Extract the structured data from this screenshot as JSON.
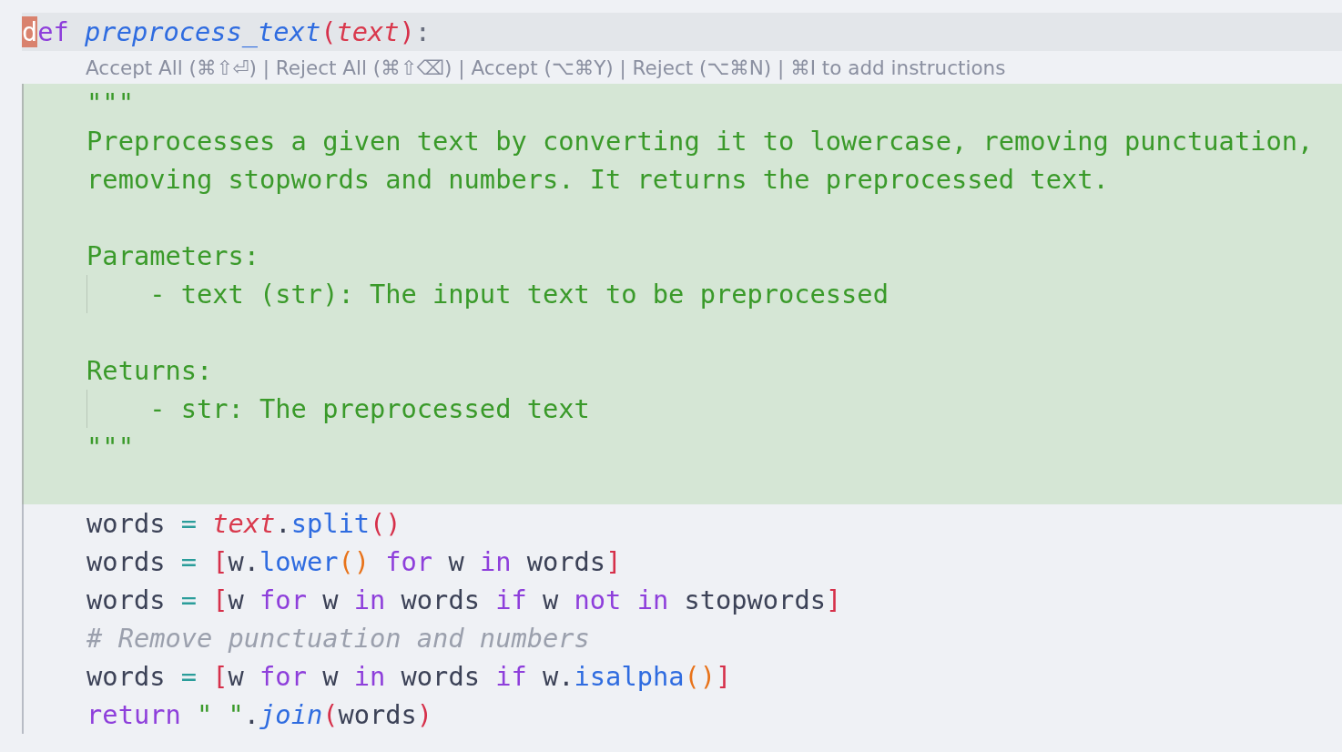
{
  "editor": {
    "header_line": {
      "tokens": [
        {
          "t": "d",
          "kind": "cursor"
        },
        {
          "t": "ef",
          "kind": "keyword"
        },
        {
          "t": " preprocess_text",
          "kind": "defname"
        },
        {
          "t": "(",
          "kind": "bracket"
        },
        {
          "t": "text",
          "kind": "param"
        },
        {
          "t": ")",
          "kind": "bracket"
        },
        {
          "t": ":",
          "kind": "punct"
        }
      ]
    },
    "inline_hint": "Accept All (⌘⇧⏎) | Reject All (⌘⇧⌫) | Accept (⌥⌘Y) | Reject (⌥⌘N) | ⌘I to add instructions",
    "added_block": {
      "lines": [
        {
          "kind": "code",
          "tokens": [
            {
              "t": "    \"\"\"",
              "kind": "doc"
            }
          ]
        },
        {
          "kind": "code",
          "tokens": [
            {
              "t": "    Preprocesses a given text by converting it to lowercase, removing punctuation,",
              "kind": "doc"
            }
          ]
        },
        {
          "kind": "code",
          "tokens": [
            {
              "t": "    removing stopwords and numbers. It returns the preprocessed text.",
              "kind": "doc"
            }
          ]
        },
        {
          "kind": "blank"
        },
        {
          "kind": "code",
          "tokens": [
            {
              "t": "    Parameters:",
              "kind": "doc"
            }
          ]
        },
        {
          "kind": "nested",
          "tokens": [
            {
              "t": "- text (str): The input text to be preprocessed",
              "kind": "doc"
            }
          ]
        },
        {
          "kind": "blank"
        },
        {
          "kind": "code",
          "tokens": [
            {
              "t": "    Returns:",
              "kind": "doc"
            }
          ]
        },
        {
          "kind": "nested",
          "tokens": [
            {
              "t": "- str: The preprocessed text",
              "kind": "doc"
            }
          ]
        },
        {
          "kind": "code",
          "tokens": [
            {
              "t": "    \"\"\"",
              "kind": "doc"
            }
          ]
        },
        {
          "kind": "blank"
        }
      ]
    },
    "lines": [
      {
        "kind": "code",
        "tokens": [
          {
            "t": "    words ",
            "kind": "plain"
          },
          {
            "t": "= ",
            "kind": "operator"
          },
          {
            "t": "text",
            "kind": "param"
          },
          {
            "t": ".",
            "kind": "plain"
          },
          {
            "t": "split",
            "kind": "method"
          },
          {
            "t": "()",
            "kind": "bracket"
          }
        ]
      },
      {
        "kind": "code",
        "tokens": [
          {
            "t": "    words ",
            "kind": "plain"
          },
          {
            "t": "= ",
            "kind": "operator"
          },
          {
            "t": "[",
            "kind": "bracket"
          },
          {
            "t": "w.",
            "kind": "plain"
          },
          {
            "t": "lower",
            "kind": "method"
          },
          {
            "t": "() ",
            "kind": "call"
          },
          {
            "t": "for",
            "kind": "keyword"
          },
          {
            "t": " w ",
            "kind": "plain"
          },
          {
            "t": "in",
            "kind": "keyword"
          },
          {
            "t": " words",
            "kind": "plain"
          },
          {
            "t": "]",
            "kind": "bracket"
          }
        ]
      },
      {
        "kind": "code",
        "tokens": [
          {
            "t": "    words ",
            "kind": "plain"
          },
          {
            "t": "= ",
            "kind": "operator"
          },
          {
            "t": "[",
            "kind": "bracket"
          },
          {
            "t": "w ",
            "kind": "plain"
          },
          {
            "t": "for",
            "kind": "keyword"
          },
          {
            "t": " w ",
            "kind": "plain"
          },
          {
            "t": "in",
            "kind": "keyword"
          },
          {
            "t": " words ",
            "kind": "plain"
          },
          {
            "t": "if",
            "kind": "keyword"
          },
          {
            "t": " w ",
            "kind": "plain"
          },
          {
            "t": "not in",
            "kind": "keyword"
          },
          {
            "t": " stopwords",
            "kind": "plain"
          },
          {
            "t": "]",
            "kind": "bracket"
          }
        ]
      },
      {
        "kind": "code",
        "tokens": [
          {
            "t": "    # Remove punctuation and numbers",
            "kind": "comment"
          }
        ]
      },
      {
        "kind": "code",
        "tokens": [
          {
            "t": "    words ",
            "kind": "plain"
          },
          {
            "t": "= ",
            "kind": "operator"
          },
          {
            "t": "[",
            "kind": "bracket"
          },
          {
            "t": "w ",
            "kind": "plain"
          },
          {
            "t": "for",
            "kind": "keyword"
          },
          {
            "t": " w ",
            "kind": "plain"
          },
          {
            "t": "in",
            "kind": "keyword"
          },
          {
            "t": " words ",
            "kind": "plain"
          },
          {
            "t": "if",
            "kind": "keyword"
          },
          {
            "t": " w.",
            "kind": "plain"
          },
          {
            "t": "isalpha",
            "kind": "method"
          },
          {
            "t": "()",
            "kind": "call"
          },
          {
            "t": "]",
            "kind": "bracket"
          }
        ]
      },
      {
        "kind": "code",
        "tokens": [
          {
            "t": "    return",
            "kind": "keyword"
          },
          {
            "t": " \" \"",
            "kind": "string"
          },
          {
            "t": ".",
            "kind": "plain"
          },
          {
            "t": "join",
            "kind": "defname"
          },
          {
            "t": "(",
            "kind": "bracket"
          },
          {
            "t": "words",
            "kind": "plain"
          },
          {
            "t": ")",
            "kind": "bracket"
          }
        ]
      }
    ]
  }
}
